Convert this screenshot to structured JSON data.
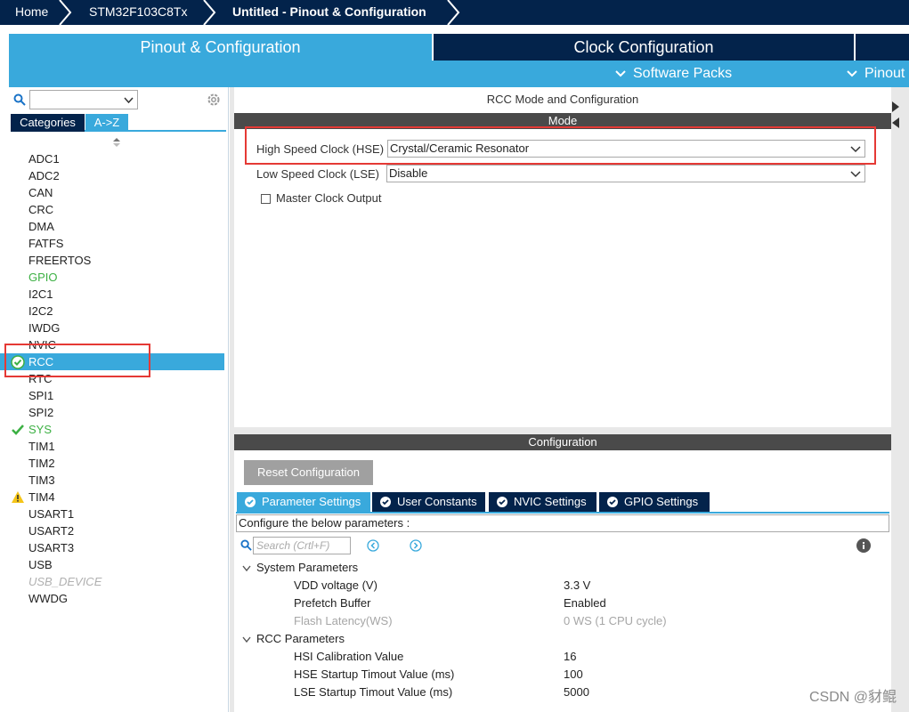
{
  "breadcrumb": {
    "home": "Home",
    "device": "STM32F103C8Tx",
    "current": "Untitled - Pinout & Configuration"
  },
  "top_tabs": {
    "pinout": "Pinout & Configuration",
    "clock": "Clock Configuration"
  },
  "sub_menu": {
    "software_packs": "Software Packs",
    "pinout": "Pinout"
  },
  "left": {
    "categories_tab": "Categories",
    "az_tab": "A->Z",
    "items": [
      {
        "label": "ADC1",
        "state": "normal"
      },
      {
        "label": "ADC2",
        "state": "normal"
      },
      {
        "label": "CAN",
        "state": "normal"
      },
      {
        "label": "CRC",
        "state": "normal"
      },
      {
        "label": "DMA",
        "state": "normal"
      },
      {
        "label": "FATFS",
        "state": "normal"
      },
      {
        "label": "FREERTOS",
        "state": "normal"
      },
      {
        "label": "GPIO",
        "state": "green"
      },
      {
        "label": "I2C1",
        "state": "normal"
      },
      {
        "label": "I2C2",
        "state": "normal"
      },
      {
        "label": "IWDG",
        "state": "normal"
      },
      {
        "label": "NVIC",
        "state": "normal"
      },
      {
        "label": "RCC",
        "state": "selected"
      },
      {
        "label": "RTC",
        "state": "normal"
      },
      {
        "label": "SPI1",
        "state": "normal"
      },
      {
        "label": "SPI2",
        "state": "normal"
      },
      {
        "label": "SYS",
        "state": "check"
      },
      {
        "label": "TIM1",
        "state": "normal"
      },
      {
        "label": "TIM2",
        "state": "normal"
      },
      {
        "label": "TIM3",
        "state": "normal"
      },
      {
        "label": "TIM4",
        "state": "warning"
      },
      {
        "label": "USART1",
        "state": "normal"
      },
      {
        "label": "USART2",
        "state": "normal"
      },
      {
        "label": "USART3",
        "state": "normal"
      },
      {
        "label": "USB",
        "state": "normal"
      },
      {
        "label": "USB_DEVICE",
        "state": "disabled"
      },
      {
        "label": "WWDG",
        "state": "normal"
      }
    ]
  },
  "mode": {
    "panel_title": "RCC Mode and Configuration",
    "header": "Mode",
    "hse_label": "High Speed Clock (HSE)",
    "hse_value": "Crystal/Ceramic Resonator",
    "lse_label": "Low Speed Clock (LSE)",
    "lse_value": "Disable",
    "mco_label": "Master Clock Output"
  },
  "config": {
    "header": "Configuration",
    "reset_button": "Reset Configuration",
    "tabs": [
      "Parameter Settings",
      "User Constants",
      "NVIC Settings",
      "GPIO Settings"
    ],
    "hint": "Configure the below parameters :",
    "search_placeholder": "Search (Crtl+F)",
    "groups": [
      {
        "name": "System Parameters",
        "params": [
          {
            "name": "VDD voltage (V)",
            "value": "3.3 V",
            "muted": false
          },
          {
            "name": "Prefetch Buffer",
            "value": "Enabled",
            "muted": false
          },
          {
            "name": "Flash Latency(WS)",
            "value": "0 WS (1 CPU cycle)",
            "muted": true
          }
        ]
      },
      {
        "name": "RCC Parameters",
        "params": [
          {
            "name": "HSI Calibration Value",
            "value": "16",
            "muted": false
          },
          {
            "name": "HSE Startup Timout Value (ms)",
            "value": "100",
            "muted": false
          },
          {
            "name": "LSE Startup Timout Value (ms)",
            "value": "5000",
            "muted": false
          }
        ]
      }
    ]
  },
  "watermark": "CSDN @豺鲲",
  "colors": {
    "navy": "#03234b",
    "accent": "#39a9dc",
    "green": "#3cb043",
    "highlight": "#e53935"
  }
}
